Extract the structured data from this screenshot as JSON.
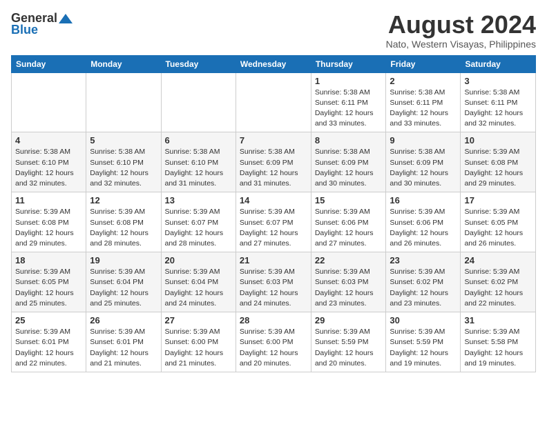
{
  "logo": {
    "general": "General",
    "blue": "Blue"
  },
  "title": "August 2024",
  "subtitle": "Nato, Western Visayas, Philippines",
  "headers": [
    "Sunday",
    "Monday",
    "Tuesday",
    "Wednesday",
    "Thursday",
    "Friday",
    "Saturday"
  ],
  "weeks": [
    [
      {
        "day": "",
        "info": ""
      },
      {
        "day": "",
        "info": ""
      },
      {
        "day": "",
        "info": ""
      },
      {
        "day": "",
        "info": ""
      },
      {
        "day": "1",
        "info": "Sunrise: 5:38 AM\nSunset: 6:11 PM\nDaylight: 12 hours\nand 33 minutes."
      },
      {
        "day": "2",
        "info": "Sunrise: 5:38 AM\nSunset: 6:11 PM\nDaylight: 12 hours\nand 33 minutes."
      },
      {
        "day": "3",
        "info": "Sunrise: 5:38 AM\nSunset: 6:11 PM\nDaylight: 12 hours\nand 32 minutes."
      }
    ],
    [
      {
        "day": "4",
        "info": "Sunrise: 5:38 AM\nSunset: 6:10 PM\nDaylight: 12 hours\nand 32 minutes."
      },
      {
        "day": "5",
        "info": "Sunrise: 5:38 AM\nSunset: 6:10 PM\nDaylight: 12 hours\nand 32 minutes."
      },
      {
        "day": "6",
        "info": "Sunrise: 5:38 AM\nSunset: 6:10 PM\nDaylight: 12 hours\nand 31 minutes."
      },
      {
        "day": "7",
        "info": "Sunrise: 5:38 AM\nSunset: 6:09 PM\nDaylight: 12 hours\nand 31 minutes."
      },
      {
        "day": "8",
        "info": "Sunrise: 5:38 AM\nSunset: 6:09 PM\nDaylight: 12 hours\nand 30 minutes."
      },
      {
        "day": "9",
        "info": "Sunrise: 5:38 AM\nSunset: 6:09 PM\nDaylight: 12 hours\nand 30 minutes."
      },
      {
        "day": "10",
        "info": "Sunrise: 5:39 AM\nSunset: 6:08 PM\nDaylight: 12 hours\nand 29 minutes."
      }
    ],
    [
      {
        "day": "11",
        "info": "Sunrise: 5:39 AM\nSunset: 6:08 PM\nDaylight: 12 hours\nand 29 minutes."
      },
      {
        "day": "12",
        "info": "Sunrise: 5:39 AM\nSunset: 6:08 PM\nDaylight: 12 hours\nand 28 minutes."
      },
      {
        "day": "13",
        "info": "Sunrise: 5:39 AM\nSunset: 6:07 PM\nDaylight: 12 hours\nand 28 minutes."
      },
      {
        "day": "14",
        "info": "Sunrise: 5:39 AM\nSunset: 6:07 PM\nDaylight: 12 hours\nand 27 minutes."
      },
      {
        "day": "15",
        "info": "Sunrise: 5:39 AM\nSunset: 6:06 PM\nDaylight: 12 hours\nand 27 minutes."
      },
      {
        "day": "16",
        "info": "Sunrise: 5:39 AM\nSunset: 6:06 PM\nDaylight: 12 hours\nand 26 minutes."
      },
      {
        "day": "17",
        "info": "Sunrise: 5:39 AM\nSunset: 6:05 PM\nDaylight: 12 hours\nand 26 minutes."
      }
    ],
    [
      {
        "day": "18",
        "info": "Sunrise: 5:39 AM\nSunset: 6:05 PM\nDaylight: 12 hours\nand 25 minutes."
      },
      {
        "day": "19",
        "info": "Sunrise: 5:39 AM\nSunset: 6:04 PM\nDaylight: 12 hours\nand 25 minutes."
      },
      {
        "day": "20",
        "info": "Sunrise: 5:39 AM\nSunset: 6:04 PM\nDaylight: 12 hours\nand 24 minutes."
      },
      {
        "day": "21",
        "info": "Sunrise: 5:39 AM\nSunset: 6:03 PM\nDaylight: 12 hours\nand 24 minutes."
      },
      {
        "day": "22",
        "info": "Sunrise: 5:39 AM\nSunset: 6:03 PM\nDaylight: 12 hours\nand 23 minutes."
      },
      {
        "day": "23",
        "info": "Sunrise: 5:39 AM\nSunset: 6:02 PM\nDaylight: 12 hours\nand 23 minutes."
      },
      {
        "day": "24",
        "info": "Sunrise: 5:39 AM\nSunset: 6:02 PM\nDaylight: 12 hours\nand 22 minutes."
      }
    ],
    [
      {
        "day": "25",
        "info": "Sunrise: 5:39 AM\nSunset: 6:01 PM\nDaylight: 12 hours\nand 22 minutes."
      },
      {
        "day": "26",
        "info": "Sunrise: 5:39 AM\nSunset: 6:01 PM\nDaylight: 12 hours\nand 21 minutes."
      },
      {
        "day": "27",
        "info": "Sunrise: 5:39 AM\nSunset: 6:00 PM\nDaylight: 12 hours\nand 21 minutes."
      },
      {
        "day": "28",
        "info": "Sunrise: 5:39 AM\nSunset: 6:00 PM\nDaylight: 12 hours\nand 20 minutes."
      },
      {
        "day": "29",
        "info": "Sunrise: 5:39 AM\nSunset: 5:59 PM\nDaylight: 12 hours\nand 20 minutes."
      },
      {
        "day": "30",
        "info": "Sunrise: 5:39 AM\nSunset: 5:59 PM\nDaylight: 12 hours\nand 19 minutes."
      },
      {
        "day": "31",
        "info": "Sunrise: 5:39 AM\nSunset: 5:58 PM\nDaylight: 12 hours\nand 19 minutes."
      }
    ]
  ]
}
